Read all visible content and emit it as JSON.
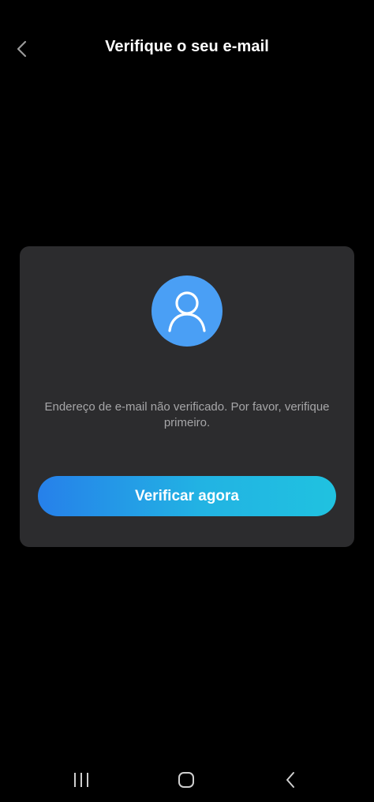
{
  "header": {
    "title": "Verifique o seu e-mail",
    "back_icon": "chevron-left-icon"
  },
  "card": {
    "avatar_icon": "user-icon",
    "message": "Endereço de e-mail não verificado. Por favor, verifique primeiro.",
    "verify_button_label": "Verificar agora"
  },
  "nav_bar": {
    "icons": [
      "recent-apps-icon",
      "home-icon",
      "back-icon"
    ]
  },
  "colors": {
    "background": "#000000",
    "card": "#2c2c2e",
    "avatar": "#4a9ff5",
    "button_gradient_start": "#2680ea",
    "button_gradient_end": "#20c2e0",
    "message_text": "#a6a6a8"
  }
}
